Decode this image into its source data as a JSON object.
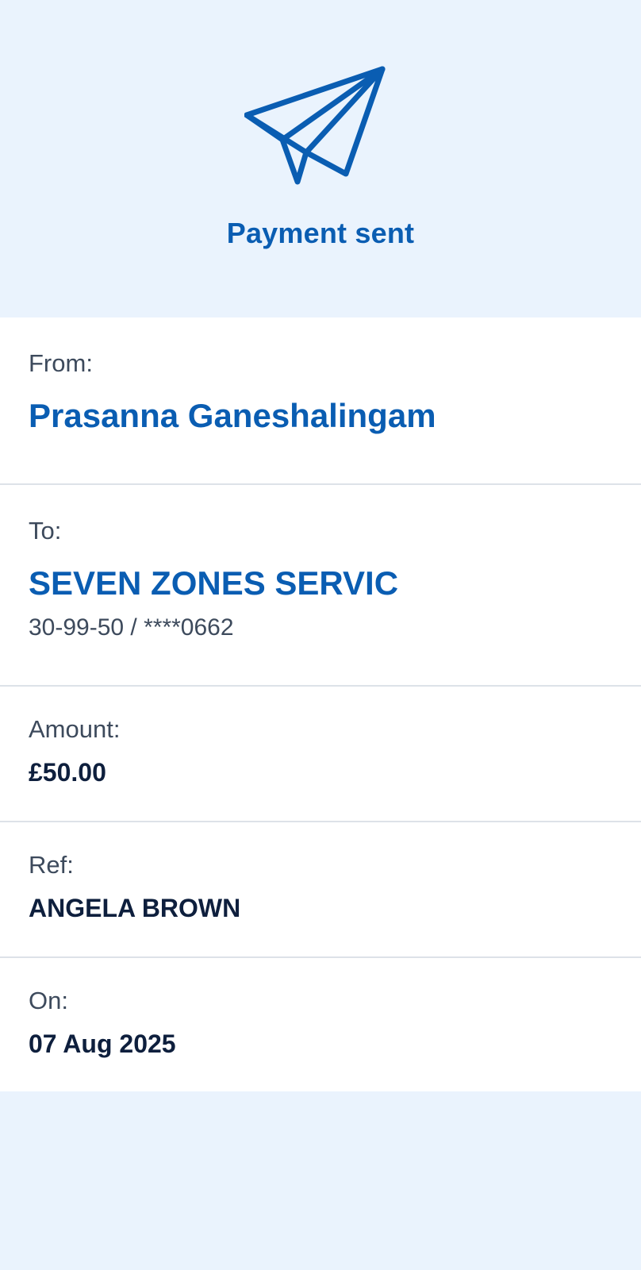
{
  "header": {
    "icon": "paper-plane-icon",
    "title": "Payment sent"
  },
  "details": {
    "from": {
      "label": "From:",
      "name": "Prasanna Ganeshalingam"
    },
    "to": {
      "label": "To:",
      "name": "SEVEN ZONES SERVIC",
      "account": "30-99-50 / ****0662"
    },
    "amount": {
      "label": "Amount:",
      "value": "£50.00"
    },
    "ref": {
      "label": "Ref:",
      "value": "ANGELA BROWN"
    },
    "on": {
      "label": "On:",
      "value": "07 Aug 2025"
    }
  },
  "colors": {
    "accent": "#0a5db2",
    "background": "#eaf3fd",
    "text_dark": "#0e1f3d",
    "text_muted": "#3d4a5c"
  }
}
